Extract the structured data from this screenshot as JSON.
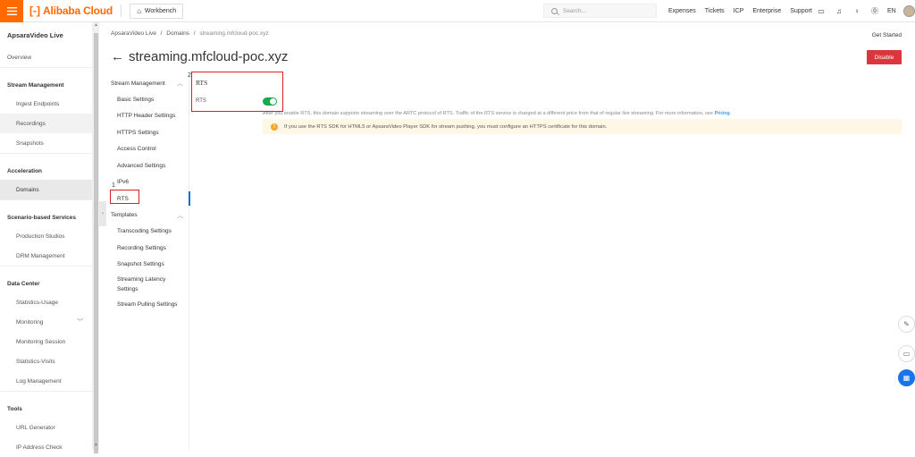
{
  "topbar": {
    "logo_text": "Alibaba Cloud",
    "workbench_label": "Workbench",
    "search_placeholder": "Search...",
    "links": [
      "Expenses",
      "Tickets",
      "ICP",
      "Enterprise",
      "Support"
    ],
    "language": "EN"
  },
  "sidebar": {
    "title": "ApsaraVideo Live",
    "overview": "Overview",
    "groups": [
      {
        "label": "Stream Management",
        "items": [
          "Ingest Endpoints",
          "Recordings",
          "Snapshots"
        ]
      },
      {
        "label": "Acceleration",
        "items": [
          "Domains"
        ]
      },
      {
        "label": "Scenario-based Services",
        "items": [
          "Production Studios",
          "DRM Management"
        ]
      },
      {
        "label": "Data Center",
        "items": [
          "Statistics-Usage",
          "Monitoring",
          "Monitoring Session",
          "Statistics-Visits",
          "Log Management"
        ]
      },
      {
        "label": "Tools",
        "items": [
          "URL Generator",
          "IP Address Check"
        ]
      }
    ]
  },
  "breadcrumb": {
    "items": [
      "ApsaraVideo Live",
      "Domains",
      "streaming.mfcloud-poc.xyz"
    ],
    "separator": "/"
  },
  "header": {
    "get_started": "Get Started",
    "title": "streaming.mfcloud-poc.xyz",
    "disable_label": "Disable"
  },
  "subnav": {
    "sections": [
      {
        "label": "Stream Management",
        "items": [
          "Basic Settings",
          "HTTP Header Settings",
          "HTTPS Settings",
          "Access Control",
          "Advanced Settings",
          "IPv6",
          "RTS"
        ]
      },
      {
        "label": "Templates",
        "items": [
          "Transcoding Settings",
          "Recording Settings",
          "Snapshot Settings",
          "Streaming Latency Settings",
          "Stream Pulling Settings"
        ]
      }
    ]
  },
  "content": {
    "section_title": "RTS",
    "toggle_label": "RTS",
    "toggle_on": true,
    "description": "After you enable RTS, this domain supports streaming over the ARTC protocol of RTS. Traffic of the RTS service is charged at a different price from that of regular live streaming. For more information, see ",
    "pricing_link": "Pricing.",
    "notice": "If you use the RTS SDK for HTML5 or ApsaraVideo Player SDK for stream pushing, you must configure an HTTPS certificate for this domain."
  },
  "annotations": [
    "1",
    "2"
  ],
  "colors": {
    "brand": "#ff6a00",
    "danger": "#d9363e",
    "toggle_on": "#19a84b",
    "link": "#0070cc",
    "annotation": "#e02020"
  }
}
